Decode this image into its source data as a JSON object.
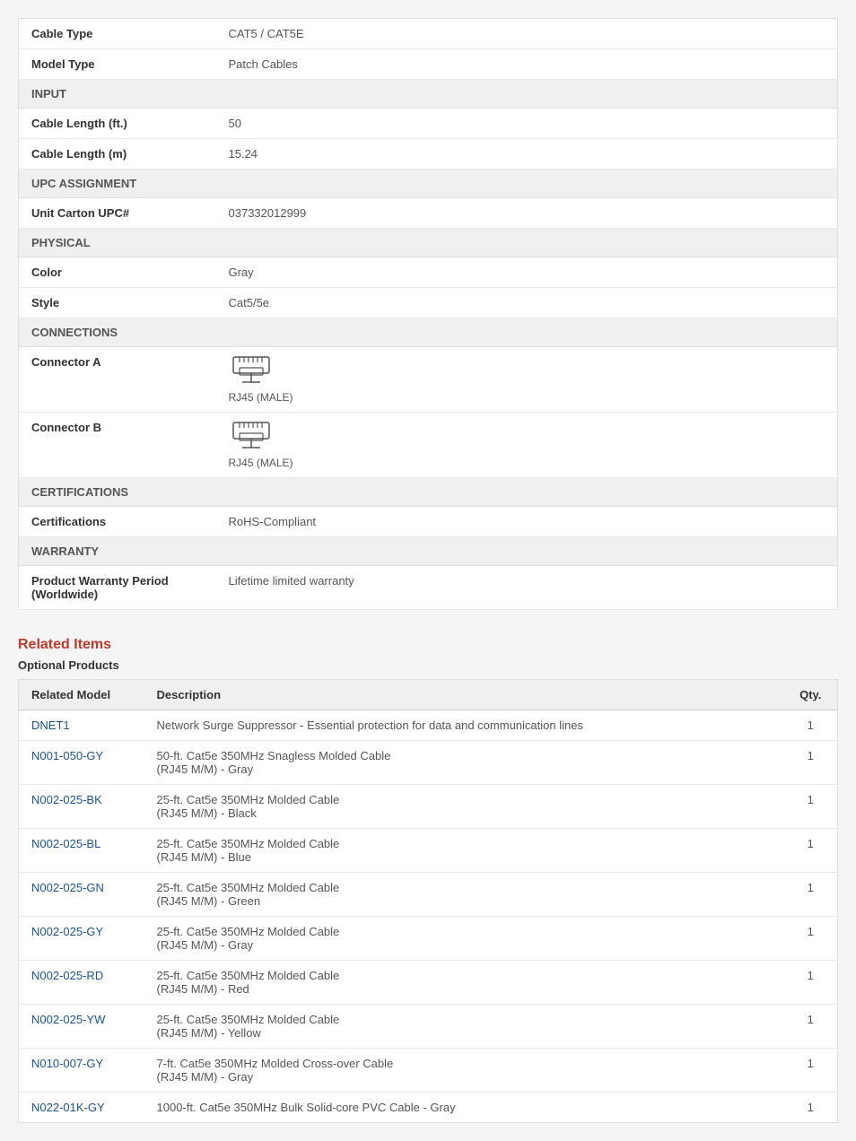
{
  "specs": {
    "rows": [
      {
        "type": "data",
        "label": "Cable Type",
        "value": "CAT5 / CAT5E"
      },
      {
        "type": "data",
        "label": "Model Type",
        "value": "Patch Cables"
      },
      {
        "type": "section",
        "label": "INPUT"
      },
      {
        "type": "data",
        "label": "Cable Length (ft.)",
        "value": "50"
      },
      {
        "type": "data",
        "label": "Cable Length (m)",
        "value": "15.24"
      },
      {
        "type": "section",
        "label": "UPC ASSIGNMENT"
      },
      {
        "type": "data",
        "label": "Unit Carton UPC#",
        "value": "037332012999"
      },
      {
        "type": "section",
        "label": "PHYSICAL"
      },
      {
        "type": "data",
        "label": "Color",
        "value": "Gray"
      },
      {
        "type": "data",
        "label": "Style",
        "value": "Cat5/5e"
      },
      {
        "type": "section",
        "label": "CONNECTIONS"
      },
      {
        "type": "connector",
        "label": "Connector A",
        "icon": "🔌",
        "value": "RJ45 (MALE)"
      },
      {
        "type": "connector",
        "label": "Connector B",
        "icon": "🔌",
        "value": "RJ45 (MALE)"
      },
      {
        "type": "section",
        "label": "CERTIFICATIONS"
      },
      {
        "type": "data",
        "label": "Certifications",
        "value": "RoHS-Compliant"
      },
      {
        "type": "section",
        "label": "WARRANTY"
      },
      {
        "type": "data-multiline",
        "label": "Product Warranty Period\n(Worldwide)",
        "value": "Lifetime limited warranty"
      }
    ]
  },
  "related_items": {
    "title": "Related Items",
    "subtitle": "Optional Products",
    "columns": {
      "model": "Related Model",
      "description": "Description",
      "qty": "Qty."
    },
    "rows": [
      {
        "model": "DNET1",
        "description": "Network Surge Suppressor - Essential protection for data and communication lines",
        "qty": "1"
      },
      {
        "model": "N001-050-GY",
        "description": "50-ft. Cat5e 350MHz Snagless Molded Cable\n(RJ45 M/M) - Gray",
        "qty": "1"
      },
      {
        "model": "N002-025-BK",
        "description": "25-ft. Cat5e 350MHz Molded Cable\n(RJ45 M/M) - Black",
        "qty": "1"
      },
      {
        "model": "N002-025-BL",
        "description": "25-ft. Cat5e 350MHz Molded Cable\n(RJ45 M/M) - Blue",
        "qty": "1"
      },
      {
        "model": "N002-025-GN",
        "description": "25-ft. Cat5e 350MHz Molded Cable\n(RJ45 M/M) - Green",
        "qty": "1"
      },
      {
        "model": "N002-025-GY",
        "description": "25-ft. Cat5e 350MHz Molded Cable\n(RJ45 M/M) - Gray",
        "qty": "1"
      },
      {
        "model": "N002-025-RD",
        "description": "25-ft. Cat5e 350MHz Molded Cable\n(RJ45 M/M) - Red",
        "qty": "1"
      },
      {
        "model": "N002-025-YW",
        "description": "25-ft. Cat5e 350MHz Molded Cable\n(RJ45 M/M) - Yellow",
        "qty": "1"
      },
      {
        "model": "N010-007-GY",
        "description": "7-ft. Cat5e 350MHz Molded Cross-over Cable\n(RJ45 M/M) - Gray",
        "qty": "1"
      },
      {
        "model": "N022-01K-GY",
        "description": "1000-ft. Cat5e 350MHz Bulk Solid-core PVC Cable - Gray",
        "qty": "1"
      }
    ]
  }
}
